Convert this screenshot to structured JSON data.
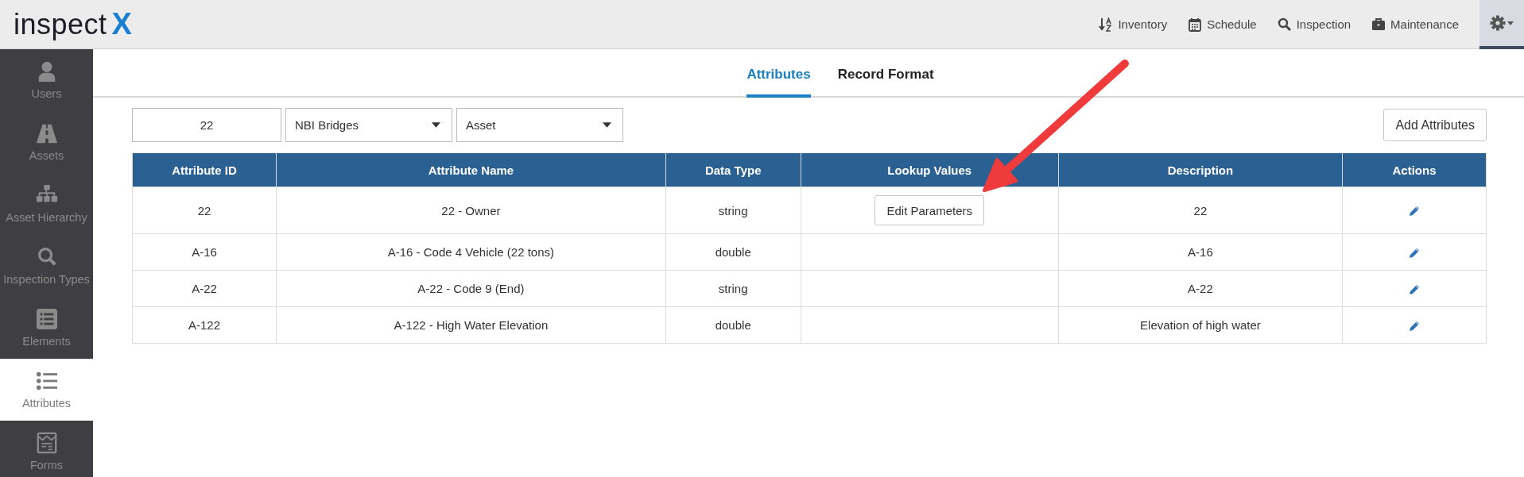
{
  "header": {
    "logo_text": "inspect",
    "logo_mark": "X",
    "nav": [
      {
        "label": "Inventory"
      },
      {
        "label": "Schedule"
      },
      {
        "label": "Inspection"
      },
      {
        "label": "Maintenance"
      }
    ]
  },
  "sidebar": {
    "items": [
      {
        "label": "Users",
        "selected": false
      },
      {
        "label": "Assets",
        "selected": false
      },
      {
        "label": "Asset Hierarchy",
        "selected": false
      },
      {
        "label": "Inspection Types",
        "selected": false
      },
      {
        "label": "Elements",
        "selected": false
      },
      {
        "label": "Attributes",
        "selected": true
      },
      {
        "label": "Forms",
        "selected": false
      }
    ]
  },
  "tabs": [
    {
      "label": "Attributes",
      "selected": true
    },
    {
      "label": "Record Format",
      "selected": false
    }
  ],
  "filters": {
    "search": "22",
    "category": "NBI Bridges",
    "type": "Asset"
  },
  "add_button": "Add Attributes",
  "table": {
    "columns": [
      "Attribute ID",
      "Attribute Name",
      "Data Type",
      "Lookup Values",
      "Description",
      "Actions"
    ],
    "rows": [
      {
        "id": "22",
        "name": "22 - Owner",
        "data_type": "string",
        "lookup_button": "Edit Parameters",
        "description": "22"
      },
      {
        "id": "A-16",
        "name": "A-16 - Code 4 Vehicle (22 tons)",
        "data_type": "double",
        "description": "A-16"
      },
      {
        "id": "A-22",
        "name": "A-22 - Code 9 (End)",
        "data_type": "string",
        "description": "A-22"
      },
      {
        "id": "A-122",
        "name": "A-122 - High Water Elevation",
        "data_type": "double",
        "description": "Elevation of high water"
      }
    ]
  }
}
